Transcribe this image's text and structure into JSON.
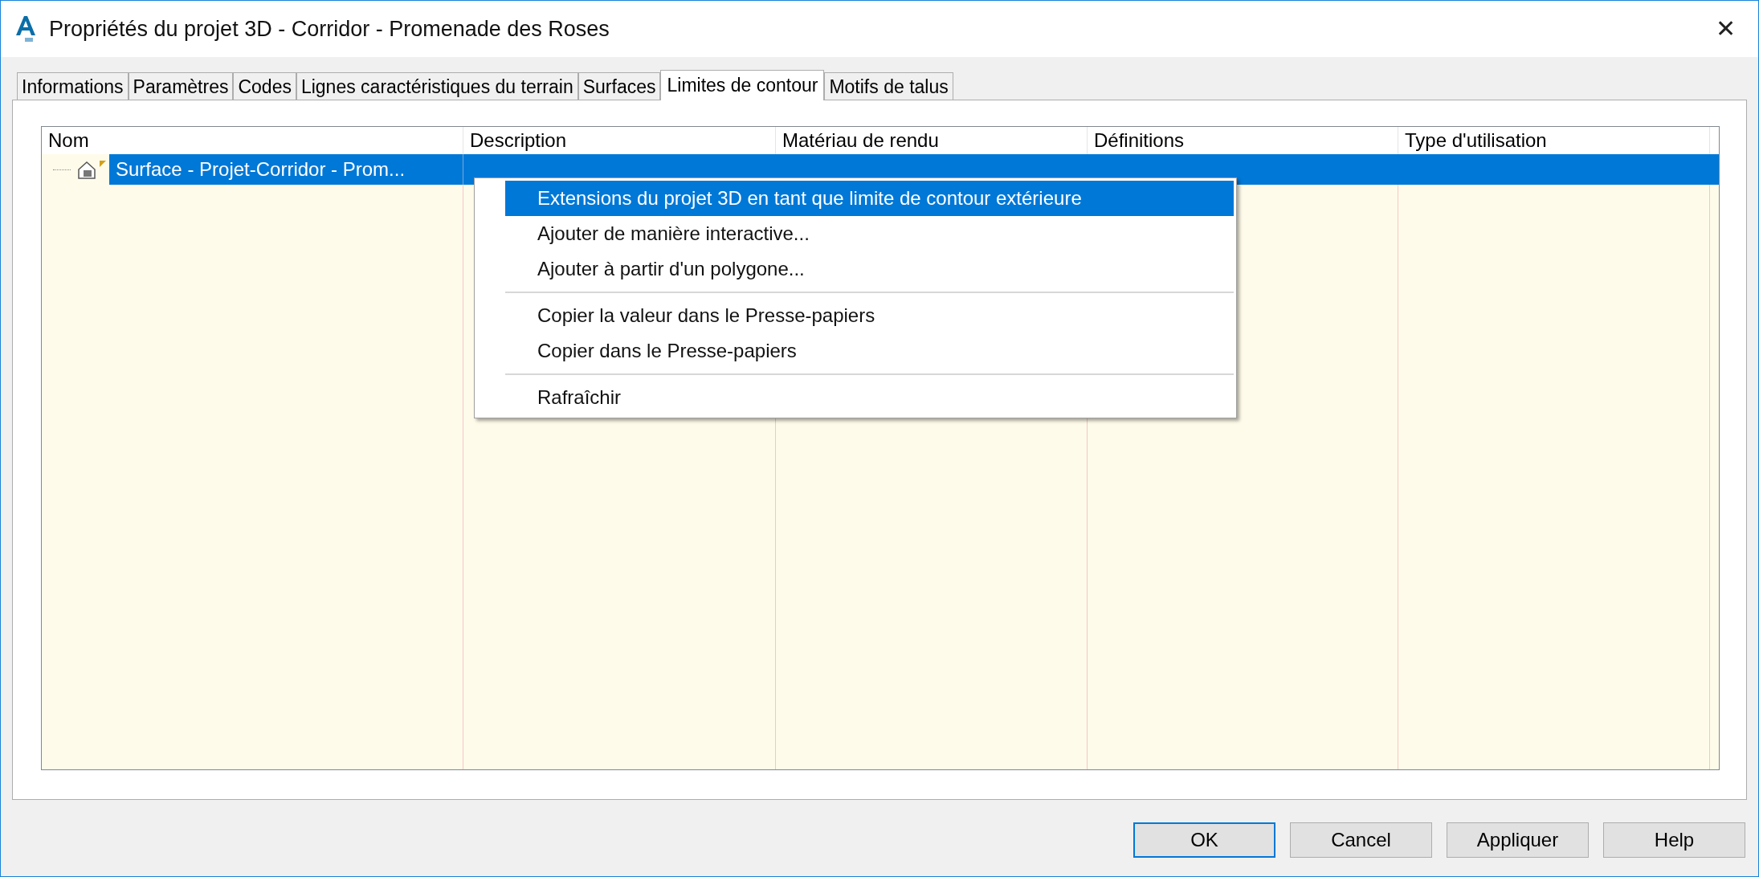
{
  "window": {
    "title": "Propriétés du projet 3D - Corridor - Promenade des Roses",
    "close": "✕"
  },
  "tabs": [
    {
      "label": "Informations",
      "selected": false
    },
    {
      "label": "Paramètres",
      "selected": false
    },
    {
      "label": "Codes",
      "selected": false
    },
    {
      "label": "Lignes caractéristiques du terrain",
      "selected": false
    },
    {
      "label": "Surfaces",
      "selected": false
    },
    {
      "label": "Limites de contour",
      "selected": true
    },
    {
      "label": "Motifs de talus",
      "selected": false
    }
  ],
  "table": {
    "columns": [
      "Nom",
      "Description",
      "Matériau de rendu",
      "Définitions",
      "Type d'utilisation"
    ],
    "rows": [
      {
        "name": "Surface - Projet-Corridor - Prom...",
        "selected": true
      }
    ]
  },
  "context_menu": {
    "items": [
      {
        "kind": "item",
        "label": "Extensions du projet 3D en tant que limite de contour extérieure",
        "highlighted": true
      },
      {
        "kind": "item",
        "label": "Ajouter de manière interactive...",
        "highlighted": false
      },
      {
        "kind": "item",
        "label": "Ajouter à partir d'un polygone...",
        "highlighted": false
      },
      {
        "kind": "separator"
      },
      {
        "kind": "item",
        "label": "Copier la valeur dans le Presse-papiers",
        "highlighted": false
      },
      {
        "kind": "item",
        "label": "Copier dans le Presse-papiers",
        "highlighted": false
      },
      {
        "kind": "separator"
      },
      {
        "kind": "item",
        "label": "Rafraîchir",
        "highlighted": false
      }
    ]
  },
  "buttons": [
    {
      "label": "OK",
      "default": true
    },
    {
      "label": "Cancel",
      "default": false
    },
    {
      "label": "Appliquer",
      "default": false
    },
    {
      "label": "Help",
      "default": false
    }
  ]
}
